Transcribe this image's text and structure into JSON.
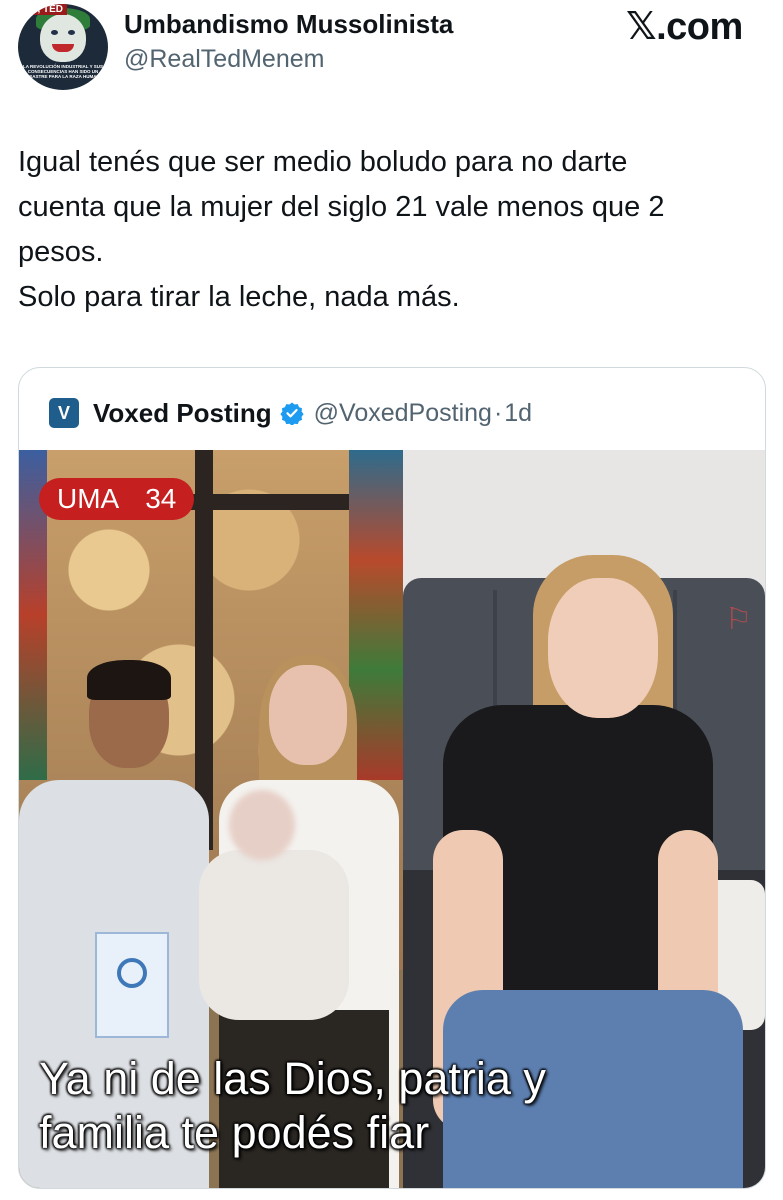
{
  "author": {
    "name": "Umbandismo Mussolinista",
    "handle": "@RealTedMenem",
    "avatar_tag": "SÍ, TED",
    "avatar_caption": "LA REVOLUCIÓN INDUSTRIAL Y SUS CONSECUENCIAS HAN SIDO UN DESASTRE PARA LA RAZA HUMANA"
  },
  "brand": "𝕏.com",
  "tweet": {
    "text": "Igual tenés que ser medio boludo para no darte\ncuenta que la mujer del siglo 21 vale menos que 2\npesos.\nSolo para tirar la leche, nada más."
  },
  "quote": {
    "avatar_letter": "V",
    "name": "Voxed Posting",
    "handle": "@VoxedPosting",
    "separator": "·",
    "time": "1d",
    "verified_icon": "verified-badge-icon",
    "colors": {
      "verified": "#1d9bf0",
      "badge": "#c61f1f",
      "avatar_bg": "#1f5d8c"
    },
    "media": {
      "badge_label": "UMA",
      "badge_number": "34",
      "caption": "Ya ni de las Dios, patria y\nfamilia te podés fiar"
    }
  }
}
